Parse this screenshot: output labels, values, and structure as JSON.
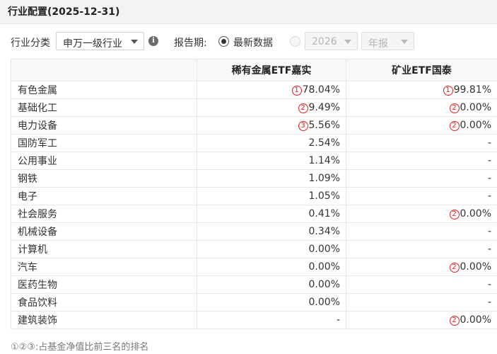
{
  "panel": {
    "title": "行业配置(2025-12-31)"
  },
  "filters": {
    "industry_label": "行业分类",
    "industry_value": "申万一级行业",
    "info_icon": "info-circle-icon",
    "period_label": "报告期:",
    "latest_label": "最新数据",
    "year_value": "2026",
    "report_type_value": "年报"
  },
  "table": {
    "headers": [
      "",
      "稀有金属ETF嘉实",
      "矿业ETF国泰"
    ],
    "rows": [
      {
        "name": "有色金属",
        "a_rank": "1",
        "a_value": "78.04%",
        "b_rank": "1",
        "b_value": "99.81%"
      },
      {
        "name": "基础化工",
        "a_rank": "2",
        "a_value": "9.49%",
        "b_rank": "2",
        "b_value": "0.00%"
      },
      {
        "name": "电力设备",
        "a_rank": "3",
        "a_value": "5.56%",
        "b_rank": "2",
        "b_value": "0.00%"
      },
      {
        "name": "国防军工",
        "a_rank": "",
        "a_value": "2.54%",
        "b_rank": "",
        "b_value": "-"
      },
      {
        "name": "公用事业",
        "a_rank": "",
        "a_value": "1.14%",
        "b_rank": "",
        "b_value": "-"
      },
      {
        "name": "钢铁",
        "a_rank": "",
        "a_value": "1.09%",
        "b_rank": "",
        "b_value": "-"
      },
      {
        "name": "电子",
        "a_rank": "",
        "a_value": "1.05%",
        "b_rank": "",
        "b_value": "-"
      },
      {
        "name": "社会服务",
        "a_rank": "",
        "a_value": "0.41%",
        "b_rank": "2",
        "b_value": "0.00%"
      },
      {
        "name": "机械设备",
        "a_rank": "",
        "a_value": "0.34%",
        "b_rank": "",
        "b_value": "-"
      },
      {
        "name": "计算机",
        "a_rank": "",
        "a_value": "0.00%",
        "b_rank": "",
        "b_value": "-"
      },
      {
        "name": "汽车",
        "a_rank": "",
        "a_value": "0.00%",
        "b_rank": "2",
        "b_value": "0.00%"
      },
      {
        "name": "医药生物",
        "a_rank": "",
        "a_value": "0.00%",
        "b_rank": "",
        "b_value": "-"
      },
      {
        "name": "食品饮料",
        "a_rank": "",
        "a_value": "0.00%",
        "b_rank": "",
        "b_value": "-"
      },
      {
        "name": "建筑装饰",
        "a_rank": "",
        "a_value": "-",
        "b_rank": "2",
        "b_value": "0.00%"
      }
    ]
  },
  "footnote": "①②③:占基金净值比前三名的排名",
  "colors": {
    "rank_red": "#e02020",
    "header_bg": "#f3f3f3",
    "border": "#e8e8e8"
  }
}
